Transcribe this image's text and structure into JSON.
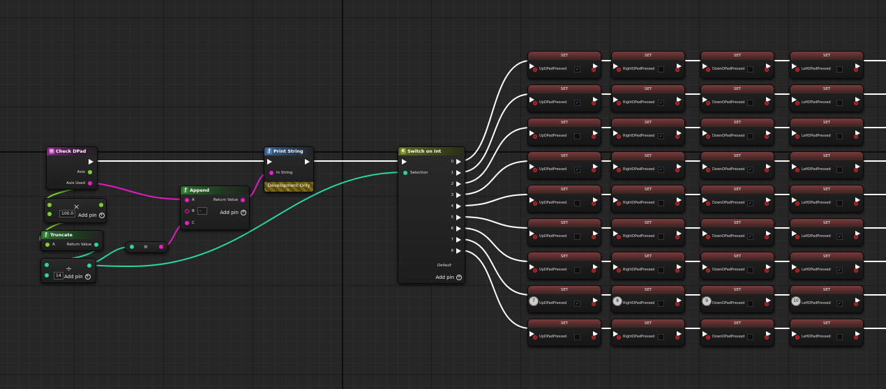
{
  "nodes": {
    "check_dpad": {
      "title": "Check DPad",
      "pin_axis": "Axis",
      "pin_axis_used": "Axis Used"
    },
    "multiply": {
      "value": "100.0",
      "add_pin": "Add pin",
      "op": "×"
    },
    "truncate": {
      "title": "Truncate",
      "pin_a": "A",
      "pin_return": "Return Value"
    },
    "divide": {
      "value": "14",
      "add_pin": "Add pin",
      "op": "÷"
    },
    "to_string": {
      "op": "≡"
    },
    "append": {
      "title": "Append",
      "pin_a": "A",
      "pin_b": "B",
      "pin_c": "C",
      "pin_return": "Return Value",
      "add_pin": "Add pin",
      "b_value": "-"
    },
    "print_string": {
      "title": "Print String",
      "pin_in": "In String",
      "dev_only": "Development Only"
    },
    "switch_on_int": {
      "title": "Switch on Int",
      "pin_selection": "Selection",
      "outputs": [
        "0",
        "1",
        "2",
        "3",
        "4",
        "5",
        "6",
        "7",
        "8"
      ],
      "default": "Default",
      "add_pin": "Add pin"
    }
  },
  "set_nodes": {
    "title": "SET",
    "columns": [
      "UpDPadPressed",
      "RightDPadPressed",
      "DownDPadPressed",
      "LeftDPadPressed"
    ],
    "checked": [
      [
        true,
        false,
        false,
        false
      ],
      [
        true,
        true,
        false,
        false
      ],
      [
        false,
        true,
        false,
        false
      ],
      [
        true,
        true,
        true,
        false
      ],
      [
        false,
        false,
        true,
        false
      ],
      [
        false,
        false,
        true,
        true
      ],
      [
        false,
        false,
        false,
        true
      ],
      [
        true,
        false,
        false,
        true
      ],
      [
        false,
        false,
        false,
        false
      ]
    ],
    "row8_badges": [
      "7",
      "8",
      "9",
      "10"
    ]
  },
  "colors": {
    "exec": "#ffffff",
    "float": "#9ee33f",
    "int": "#27d6a3",
    "string": "#f01bcb",
    "bool": "#8b1d1d"
  }
}
